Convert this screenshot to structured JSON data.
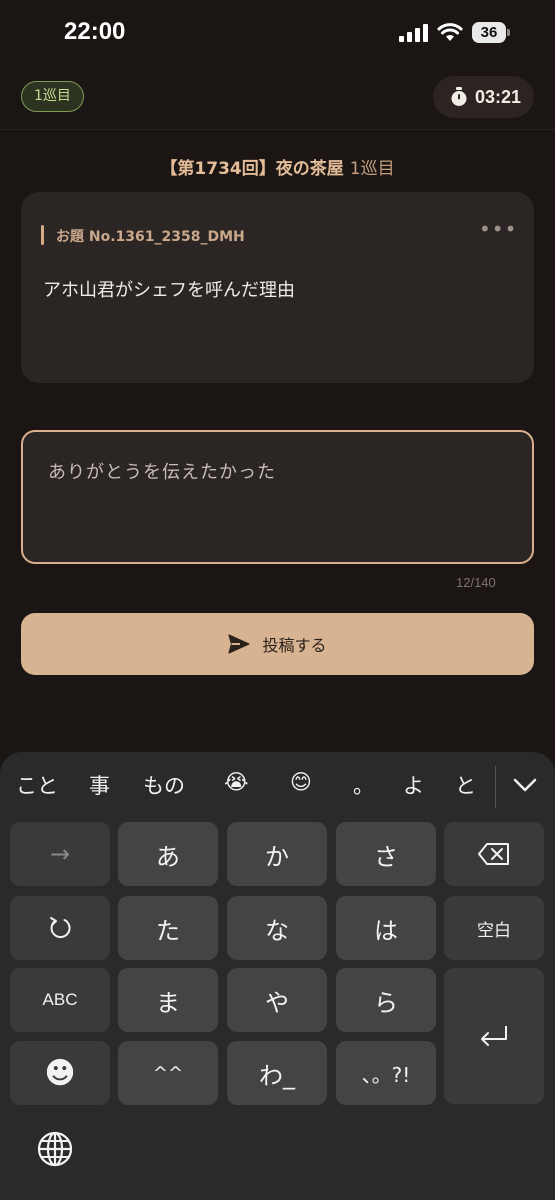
{
  "status_bar": {
    "time": "22:00",
    "battery": "36"
  },
  "header": {
    "round_badge": "1巡目",
    "timer": "03:21"
  },
  "game": {
    "title": "【第1734回】夜の茶屋",
    "round": "1巡目"
  },
  "prompt": {
    "label": "お題 No.1361_2358_DMH",
    "text": "アホ山君がシェフを呼んだ理由",
    "more": "•••"
  },
  "answer": {
    "value": "ありがとうを伝えたかった",
    "count": "12/140"
  },
  "submit": {
    "label": "投稿する"
  },
  "keyboard": {
    "suggestions": [
      "こと",
      "事",
      "もの",
      "😭",
      "😊",
      "。",
      "よ",
      "と"
    ],
    "keys": {
      "arrow": "→",
      "a": "あ",
      "ka": "か",
      "sa": "さ",
      "undo": "↺",
      "ta": "た",
      "na": "な",
      "ha": "は",
      "space": "空白",
      "abc": "ABC",
      "ma": "ま",
      "ya": "や",
      "ra": "ら",
      "emoji": "☻",
      "dakuten": "^^",
      "wa": "わ_",
      "punct": "、。?!"
    }
  }
}
